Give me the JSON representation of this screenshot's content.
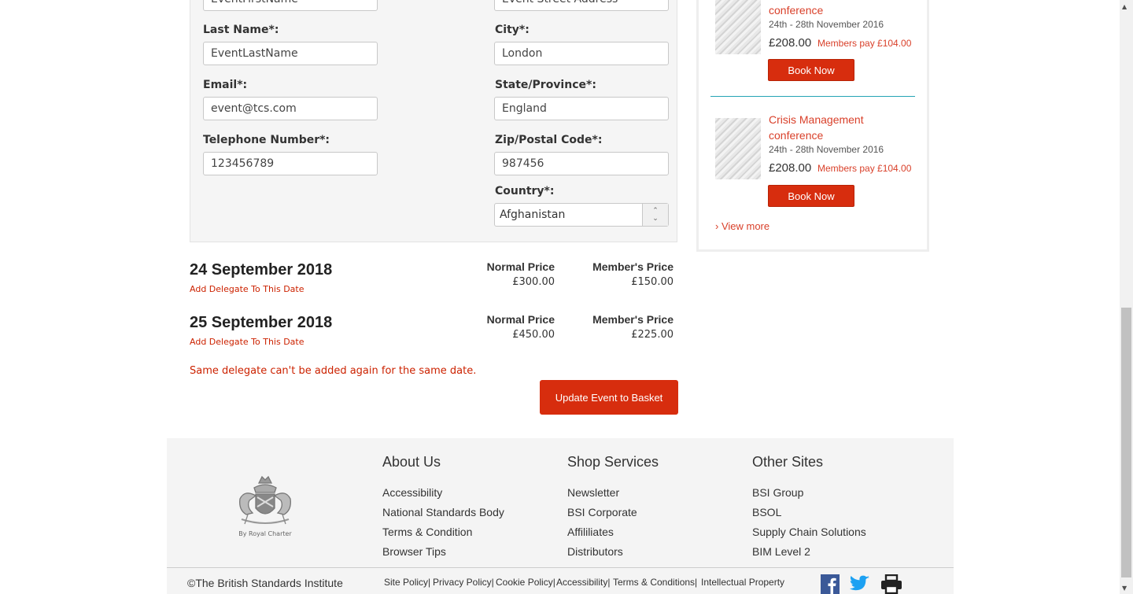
{
  "form": {
    "first_name_value": "EventFirstName",
    "street_value": "Event Street Address",
    "last_name_label": "Last Name*:",
    "last_name_value": "EventLastName",
    "city_label": "City*:",
    "city_value": "London",
    "email_label": "Email*:",
    "email_value": "event@tcs.com",
    "state_label": "State/Province*:",
    "state_value": "England",
    "phone_label": "Telephone Number*:",
    "phone_value": "123456789",
    "zip_label": "Zip/Postal Code*:",
    "zip_value": "987456",
    "country_label": "Country*:",
    "country_value": "Afghanistan"
  },
  "dates": [
    {
      "title": "24 September 2018",
      "add_link": "Add Delegate To This Date",
      "normal_label": "Normal Price",
      "normal_price": "£300.00",
      "member_label": "Member's Price",
      "member_price": "£150.00"
    },
    {
      "title": "25 September 2018",
      "add_link": "Add Delegate To This Date",
      "normal_label": "Normal Price",
      "normal_price": "£450.00",
      "member_label": "Member's Price",
      "member_price": "£225.00"
    }
  ],
  "error_message": "Same delegate can't be added again for the same date.",
  "update_button": "Update Event to Basket",
  "sidebar": {
    "events": [
      {
        "title_line2": "conference",
        "date": "24th - 28th November 2016",
        "price": "£208.00",
        "member_price": "Members pay £104.00",
        "button": "Book Now"
      },
      {
        "title_line1": "Crisis Management",
        "title_line2": "conference",
        "date": "24th - 28th November 2016",
        "price": "£208.00",
        "member_price": "Members pay £104.00",
        "button": "Book Now"
      }
    ],
    "view_more": "› View more"
  },
  "footer": {
    "crest_caption": "By Royal Charter",
    "columns": [
      {
        "heading": "About Us",
        "links": [
          "Accessibility",
          "National Standards Body",
          "Terms & Condition",
          "Browser Tips"
        ]
      },
      {
        "heading": "Shop Services",
        "links": [
          "Newsletter",
          "BSI Corporate",
          "Affililiates",
          "Distributors"
        ]
      },
      {
        "heading": "Other Sites",
        "links": [
          "BSI Group",
          "BSOL",
          "Supply Chain Solutions",
          "BIM Level 2"
        ]
      }
    ],
    "copyright": "©The British Standards Institute",
    "policy_links": [
      "Site Policy|",
      "Privacy Policy|",
      "Cookie Policy|",
      "Accessibility|",
      "Terms & Conditions|",
      "Intellectual Property"
    ],
    "social_icons": [
      "facebook-icon",
      "twitter-icon",
      "print-icon"
    ]
  },
  "colors": {
    "accent": "#d72d0e",
    "link_red": "#cc2200",
    "separator_teal": "#25a3b5",
    "facebook_blue": "#3b5998",
    "twitter_blue": "#1da1f2"
  }
}
